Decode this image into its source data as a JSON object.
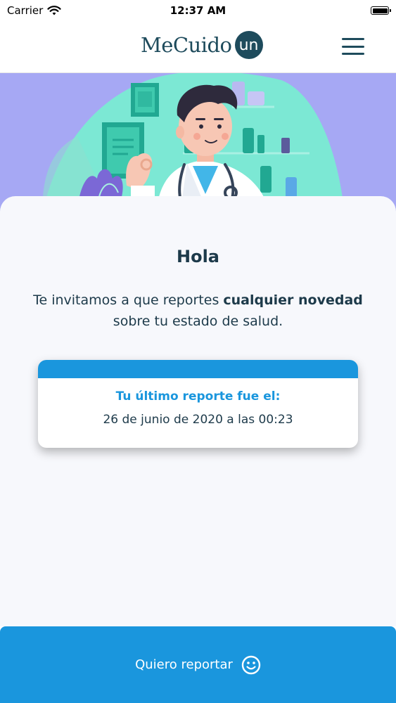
{
  "status_bar": {
    "carrier": "Carrier",
    "time": "12:37 AM"
  },
  "header": {
    "logo_text": "MeCuido",
    "logo_badge": "un"
  },
  "main": {
    "greeting": "Hola",
    "invite_prefix": "Te invitamos a que reportes ",
    "invite_bold": "cualquier novedad",
    "invite_suffix": " sobre tu estado de salud.",
    "last_report": {
      "title": "Tu último reporte fue el:",
      "date": "26 de junio de 2020 a las 00:23"
    }
  },
  "footer": {
    "report_button_label": "Quiero reportar"
  },
  "colors": {
    "brand_dark": "#1e4b5c",
    "accent_blue": "#1a96dd",
    "hero_purple": "#a6a8f4",
    "hero_mint": "#7ce8d4"
  }
}
